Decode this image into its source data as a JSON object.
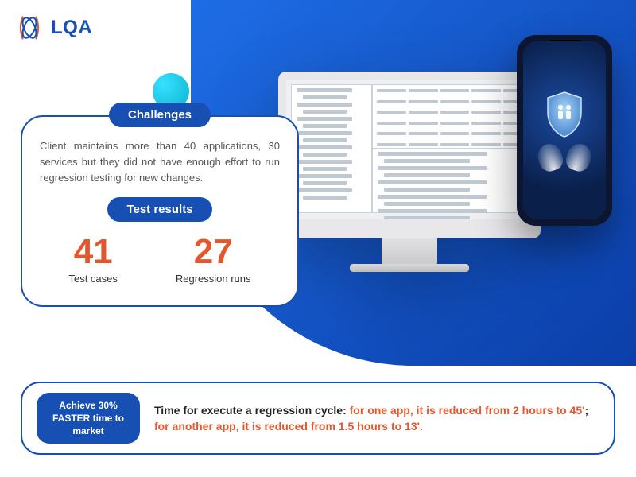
{
  "brand": {
    "name": "LQA"
  },
  "sections": {
    "challenges_label": "Challenges",
    "challenges_body": "Client maintains more than 40 applications, 30 services but they did not have enough effort to run regression testing for new changes.",
    "results_label": "Test results"
  },
  "metrics": [
    {
      "value": "41",
      "label": "Test cases"
    },
    {
      "value": "27",
      "label": "Regression runs"
    }
  ],
  "bottom": {
    "achieve": "Achieve 30% FASTER time to market",
    "lead": "Time for execute a regression cycle: ",
    "hl1": "for one app, it is reduced from 2 hours to 45'",
    "mid": "; ",
    "hl2": "for another app, it is reduced from 1.5 hours to 13'."
  },
  "icons": {
    "decor_dot": "decor-dot",
    "monitor": "desktop-monitor",
    "phone": "smartphone",
    "shield": "shield-icon",
    "hands": "cupped-hands-icon"
  }
}
